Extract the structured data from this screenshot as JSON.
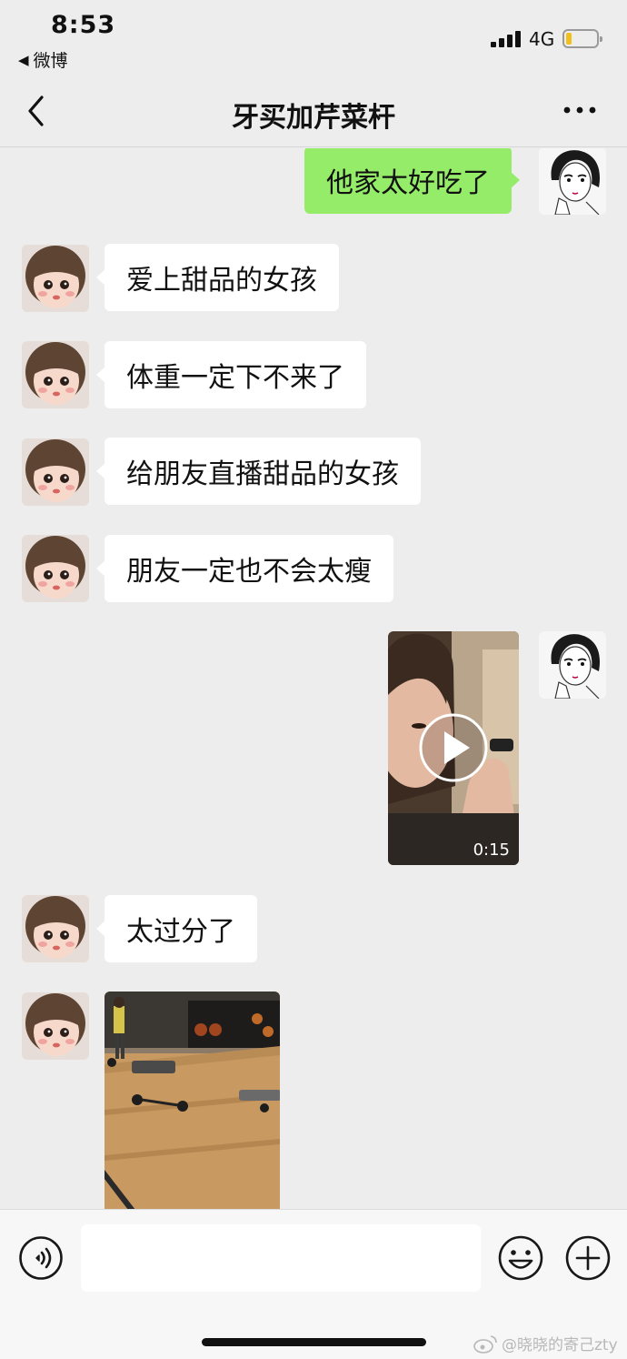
{
  "status_bar": {
    "time": "8:53",
    "back_app": "微博",
    "network": "4G",
    "battery_level": 0.18,
    "battery_color": "#f2c01e"
  },
  "nav": {
    "title": "牙买加芹菜杆"
  },
  "colors": {
    "outgoing_bubble": "#95ec69",
    "incoming_bubble": "#ffffff",
    "chat_background": "#ededed"
  },
  "messages": {
    "out_1": "他家太好吃了",
    "in_1": "爱上甜品的女孩",
    "in_2": "体重一定下不来了",
    "in_3": "给朋友直播甜品的女孩",
    "in_4": "朋友一定也不会太瘦",
    "video_duration": "0:15",
    "in_5": "太过分了"
  },
  "input_bar": {
    "voice_icon": "voice-icon",
    "emoji_icon": "emoji-icon",
    "plus_icon": "plus-icon"
  },
  "watermark": {
    "text": "@晓晓的寄己zty"
  }
}
